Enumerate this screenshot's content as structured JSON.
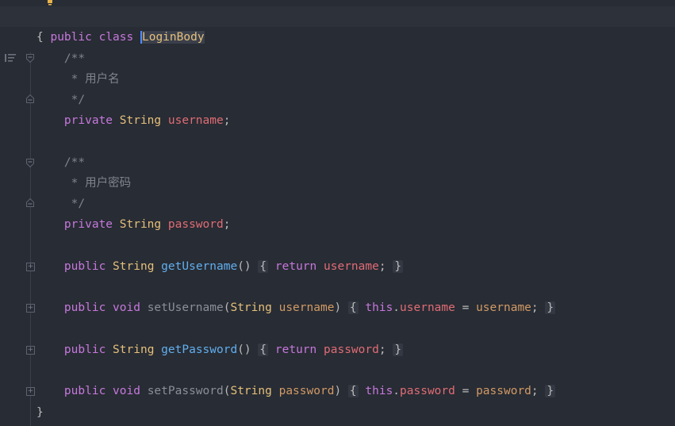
{
  "editor": {
    "class_keywords": [
      "public",
      "class"
    ],
    "class_name": "LoginBody",
    "open_brace": "{",
    "close_brace": "}",
    "comment_open": "/**",
    "comment_close": "*/",
    "comment_star": "*",
    "username_doc": "用户名",
    "password_doc": "用户密码",
    "kw_private": "private",
    "kw_public": "public",
    "kw_void": "void",
    "kw_return": "return",
    "kw_this": "this",
    "type_string": "String",
    "field_username": "username",
    "field_password": "password",
    "method_get_username": "getUsername",
    "method_set_username": "setUsername",
    "method_get_password": "getPassword",
    "method_set_password": "setPassword"
  },
  "gutter": {
    "icons": [
      "override-icon",
      "structure-icon",
      "bulb-icon"
    ]
  },
  "colors": {
    "background": "#282c34",
    "keyword": "#c678dd",
    "type": "#e5c07b",
    "field": "#e06c75",
    "method": "#61afef",
    "comment": "#7f848e"
  }
}
